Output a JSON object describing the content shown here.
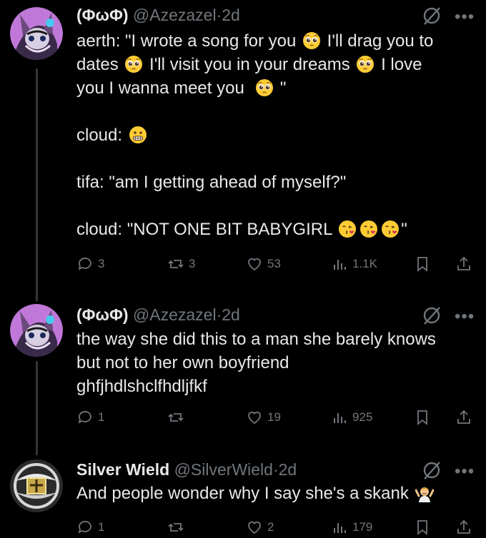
{
  "tweets": [
    {
      "name": "(ΦωΦ)",
      "handle": "@Azezazel",
      "separator": "·",
      "time": "2d",
      "lines": [
        [
          "aerth: \"I wrote a song for you ",
          "pleading",
          " I'll drag you to"
        ],
        [
          "dates ",
          "pleading",
          " I'll visit you in your dreams ",
          "pleading",
          " I love"
        ],
        [
          "you I wanna meet you  ",
          "pleading",
          " \""
        ],
        [
          ""
        ],
        [
          "cloud: ",
          "grimace"
        ],
        [
          ""
        ],
        [
          "tifa: \"am I getting ahead of myself?\""
        ],
        [
          ""
        ],
        [
          "cloud: \"NOT ONE BIT BABYGIRL ",
          "kiss",
          "kiss",
          "kiss",
          "\""
        ]
      ],
      "replies": "3",
      "reposts": "3",
      "likes": "53",
      "views": "1.1K"
    },
    {
      "name": "(ΦωΦ)",
      "handle": "@Azezazel",
      "separator": "·",
      "time": "2d",
      "lines": [
        [
          "the way she did this to a man she barely knows"
        ],
        [
          "but not to her own boyfriend"
        ],
        [
          "ghfjhdlshclfhdljfkf"
        ]
      ],
      "replies": "1",
      "reposts": "",
      "likes": "19",
      "views": "925"
    },
    {
      "name": "Silver Wield",
      "handle": "@SilverWield",
      "separator": "·",
      "time": "2d",
      "lines": [
        [
          "And people wonder why I say she's a skank ",
          "shrug"
        ]
      ],
      "replies": "1",
      "reposts": "",
      "likes": "2",
      "views": "179"
    }
  ],
  "icons": {
    "more": "more-dots-icon",
    "grok": "grok-icon",
    "reply": "reply-icon",
    "repost": "repost-icon",
    "like": "heart-icon",
    "views": "views-bar-icon",
    "bookmark": "bookmark-icon",
    "share": "share-icon"
  },
  "colors": {
    "background": "#000000",
    "text": "#e7e9ea",
    "secondary": "#71767b",
    "emoji": "#ffcc33",
    "kiss_heart": "#e0245e"
  }
}
